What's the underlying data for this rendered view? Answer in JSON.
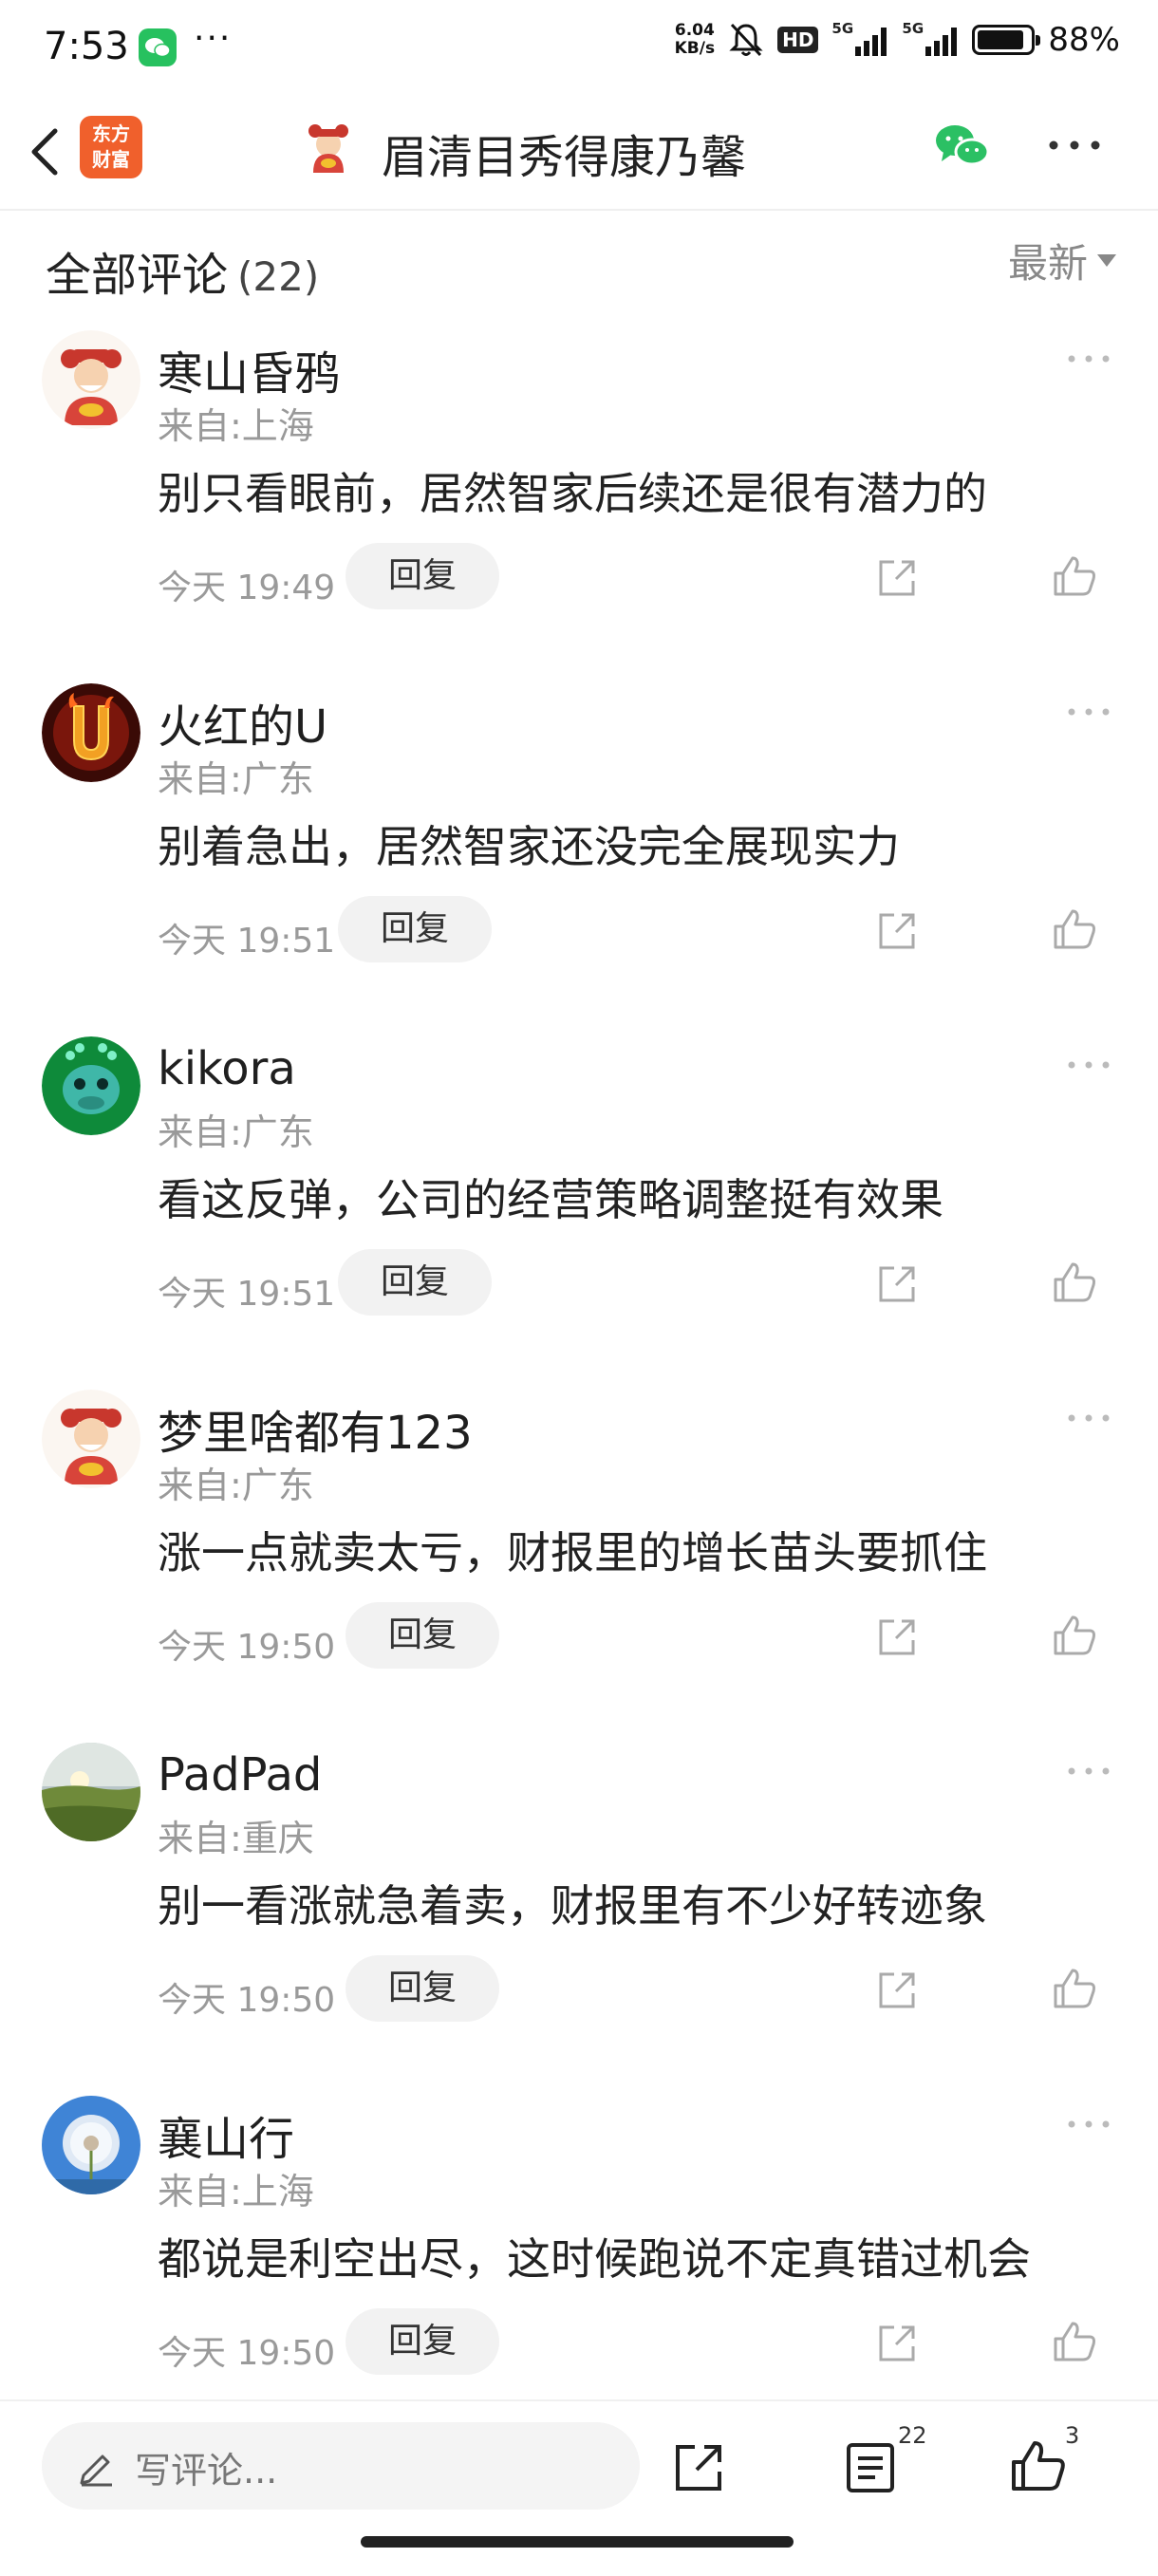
{
  "status_bar": {
    "time": "7:53",
    "net_speed_value": "6.04",
    "net_speed_unit": "KB/s",
    "hd_label": "HD",
    "signal1_label": "5G",
    "signal2_label": "5G",
    "battery_percent": "88%",
    "battery_level": 0.88
  },
  "nav": {
    "logo_text": "东方\n财富",
    "title": "眉清目秀得康乃馨"
  },
  "section": {
    "title": "全部评论",
    "count": "(22)",
    "sort_label": "最新"
  },
  "comments": [
    {
      "user": "寒山昏鸦",
      "location": "来自:上海",
      "text": "别只看眼前，居然智家后续还是很有潜力的",
      "time": "今天 19:49",
      "reply_label": "回复",
      "avatar": "caishen-avatar"
    },
    {
      "user": "火红的U",
      "location": "来自:广东",
      "text": "别着急出，居然智家还没完全展现实力",
      "time": "今天 19:51",
      "reply_label": "回复",
      "avatar": "flame-u-avatar"
    },
    {
      "user": "kikora",
      "location": "来自:广东",
      "text": "看这反弹，公司的经营策略调整挺有效果",
      "time": "今天 19:51",
      "reply_label": "回复",
      "avatar": "green-dragon-avatar"
    },
    {
      "user": "梦里啥都有123",
      "location": "来自:广东",
      "text": "涨一点就卖太亏，财报里的增长苗头要抓住",
      "time": "今天 19:50",
      "reply_label": "回复",
      "avatar": "caishen-avatar"
    },
    {
      "user": "PadPad",
      "location": "来自:重庆",
      "text": "别一看涨就急着卖，财报里有不少好转迹象",
      "time": "今天 19:50",
      "reply_label": "回复",
      "avatar": "landscape-avatar"
    },
    {
      "user": "襄山行",
      "location": "来自:上海",
      "text": "都说是利空出尽，这时候跑说不定真错过机会",
      "time": "今天 19:50",
      "reply_label": "回复",
      "avatar": "dandelion-avatar"
    }
  ],
  "bottom_bar": {
    "write_placeholder": "写评论...",
    "comments_badge": "22",
    "likes_badge": "3"
  }
}
